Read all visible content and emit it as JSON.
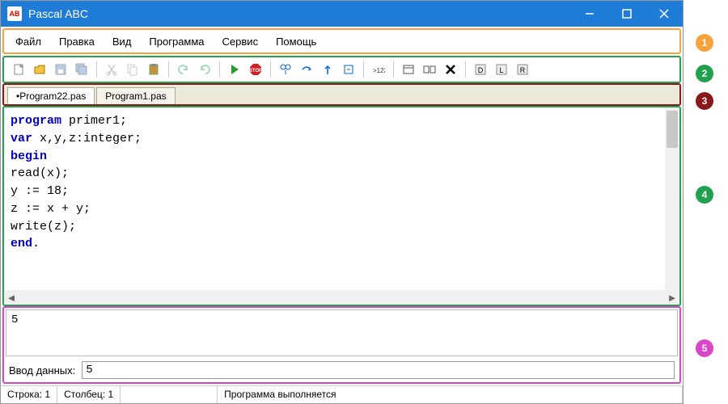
{
  "title": "Pascal ABC",
  "menu": [
    "Файл",
    "Правка",
    "Вид",
    "Программа",
    "Сервис",
    "Помощь"
  ],
  "tabs": [
    {
      "label": "•Program22.pas",
      "active": true
    },
    {
      "label": "Program1.pas",
      "active": false
    }
  ],
  "code_lines": [
    {
      "tokens": [
        {
          "t": "program",
          "kw": true
        },
        {
          "t": " primer1;",
          "kw": false
        }
      ]
    },
    {
      "tokens": [
        {
          "t": "var",
          "kw": true
        },
        {
          "t": " x,y,z:integer;",
          "kw": false
        }
      ]
    },
    {
      "tokens": [
        {
          "t": "begin",
          "kw": true
        }
      ]
    },
    {
      "tokens": [
        {
          "t": "read(x);",
          "kw": false
        }
      ]
    },
    {
      "tokens": [
        {
          "t": "y := 18;",
          "kw": false
        }
      ]
    },
    {
      "tokens": [
        {
          "t": "z := x + y;",
          "kw": false
        }
      ]
    },
    {
      "tokens": [
        {
          "t": "write(z);",
          "kw": false
        }
      ]
    },
    {
      "tokens": [
        {
          "t": "end",
          "kw": true
        },
        {
          "t": ".",
          "kw": false
        }
      ]
    }
  ],
  "output": "5",
  "input_label": "Ввод данных:",
  "input_value": "5",
  "status": {
    "line_label": "Строка:",
    "line": "1",
    "col_label": "Столбец:",
    "col": "1",
    "msg": "Программа выполняется"
  },
  "callouts": [
    "1",
    "2",
    "3",
    "4",
    "5"
  ]
}
